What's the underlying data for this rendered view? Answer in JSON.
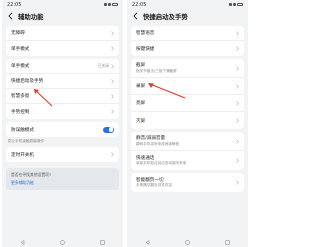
{
  "left": {
    "status": {
      "time": "22:05"
    },
    "title": "辅助功能",
    "card1": [
      {
        "title": "无障碍"
      },
      {
        "title": "单手模式"
      }
    ],
    "card2": [
      {
        "title": "单手模式",
        "value": "已关闭"
      },
      {
        "title": "快捷启动及手势"
      },
      {
        "title": "智慧多窗"
      },
      {
        "title": "手势控制"
      }
    ],
    "card3": [
      {
        "title": "防误触模式"
      }
    ],
    "hint": "防止手机误触屏幕操作",
    "card4": [
      {
        "title": "定时开关机"
      }
    ],
    "tip": {
      "question": "是否在寻找其他设置项?",
      "link": "更多辅助功能"
    }
  },
  "right": {
    "status": {
      "time": "22:05"
    },
    "title": "快捷启动及手势",
    "card1": [
      {
        "title": "智慧语音"
      },
      {
        "title": "按键快捷"
      }
    ],
    "card2": [
      {
        "title": "截屏",
        "sub": "指关节敲击/三指下滑截屏"
      },
      {
        "title": "录屏"
      },
      {
        "title": "亮屏"
      },
      {
        "title": "灭屏"
      }
    ],
    "card3": [
      {
        "title": "静音/减弱音量",
        "sub": "翻转手机将来电或闹钟静音"
      },
      {
        "title": "快速通话",
        "sub": "拿起手机贴近耳边自动接听来电"
      }
    ],
    "card4": [
      {
        "title": "智能翻页一切",
        "sub": "手势隔空翻页浏览内容"
      }
    ]
  }
}
